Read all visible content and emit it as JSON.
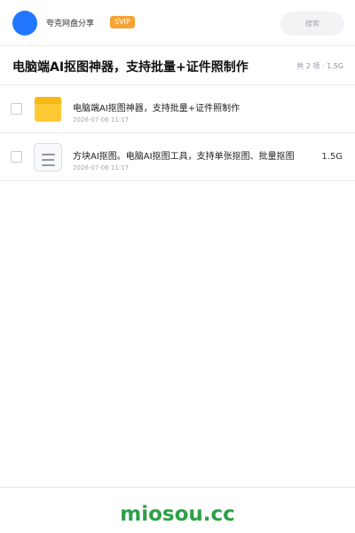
{
  "header": {
    "share_name": "夸克网盘分享",
    "vip_label": "SVIP",
    "search_placeholder": "搜索"
  },
  "title_row": {
    "title": "电脑端AI抠图神器，支持批量+证件照制作",
    "summary": "共 2 项 · 1.5G"
  },
  "files": [
    {
      "icon": "folder-icon",
      "name": "电脑端AI抠图神器，支持批量+证件照制作",
      "time": "2026-07-06 11:17",
      "size": ""
    },
    {
      "icon": "document-icon",
      "name": "方块AI抠图。电脑AI抠图工具，支持单张抠图、批量抠图",
      "time": "2026-07-06 11:17",
      "size": "1.5G"
    }
  ],
  "footer": {
    "watermark": "miosou.cc"
  },
  "colors": {
    "avatar": "#2377ff",
    "vip_badge": "#f7a434",
    "folder": "#ffc936",
    "watermark": "#2ca047"
  }
}
